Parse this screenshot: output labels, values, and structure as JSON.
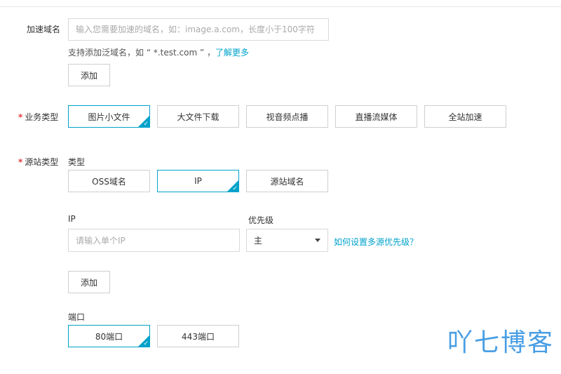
{
  "domain_section": {
    "label": "加速域名",
    "placeholder": "输入您需要加速的域名，如：image.a.com，长度小于100字符",
    "hint_prefix": "支持添加泛域名，如 “ *.test.com ” ，",
    "hint_link": "了解更多",
    "add_button": "添加"
  },
  "business_type": {
    "label": "业务类型",
    "options": [
      "图片小文件",
      "大文件下载",
      "视音频点播",
      "直播流媒体",
      "全站加速"
    ],
    "selected_index": 0
  },
  "origin_type": {
    "label": "源站类型",
    "type_label": "类型",
    "options": [
      "OSS域名",
      "IP",
      "源站域名"
    ],
    "selected_index": 1,
    "ip_label": "IP",
    "ip_placeholder": "请输入单个IP",
    "priority_label": "优先级",
    "priority_value": "主",
    "priority_help_link": "如何设置多源优先级？",
    "add_button": "添加",
    "port_label": "端口",
    "port_options": [
      "80端口",
      "443端口"
    ],
    "port_selected_index": 0
  },
  "watermark": "吖七博客",
  "colors": {
    "accent": "#00a2ca",
    "required": "#e4393c",
    "watermark": "#2a8ee0"
  }
}
